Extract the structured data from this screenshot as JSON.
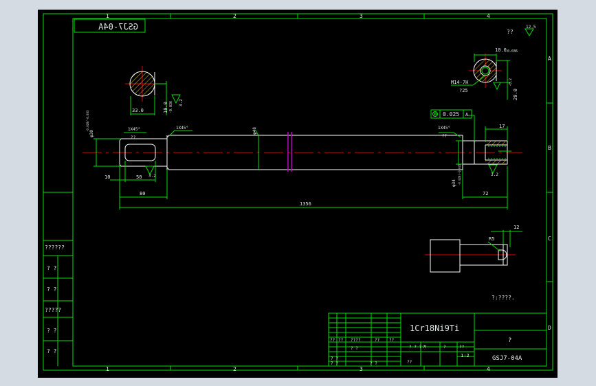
{
  "drawing": {
    "part_number_flipped": "GSJ7-04A",
    "zone_numbers_top": [
      "1",
      "2",
      "3",
      "4"
    ],
    "zone_numbers_bottom": [
      "1",
      "2",
      "3",
      "4"
    ],
    "zone_letters_right": [
      "A",
      "B",
      "C",
      "D"
    ],
    "roughness_top_right": "?? ",
    "roughness_top_right_value": "12.5",
    "left_section": {
      "width_dim": "33.0",
      "depth_dim": "10.0",
      "depth_tol": "-0.036",
      "roughness": "3.2"
    },
    "left_end": {
      "chamfer": "1X45°",
      "chamfer_note": "??",
      "dia_label": "φ30",
      "dia_tol": "-0.020/-0.033",
      "offset_dim": "10",
      "key_dim": "50",
      "length_dim": "80",
      "roughness": "3.2"
    },
    "middle": {
      "chamfer": "1X45°",
      "dia_label": "φ48"
    },
    "right_end": {
      "chamfer": "1X45°",
      "chamfer_note": "??",
      "dia_label": "φ34",
      "dia_tol": "-0.020/-0.035",
      "length_dim": "72",
      "hole_dim": "17",
      "roughness": "3.2",
      "tolerance_frame": "0.025",
      "datum": "A"
    },
    "overall_length": "1356",
    "right_section": {
      "width_dim": "10.0",
      "width_tol": "-0.036",
      "thread": "M14-7H",
      "thread_depth": "?25",
      "height_dim": "29.0",
      "height_tol": "-0.2",
      "roughness": "3.2"
    },
    "detail_view": {
      "radius": "R5",
      "length": "12"
    },
    "note_right": "?:????.",
    "left_strip_labels": [
      "??????",
      "?   ?",
      "?   ?",
      "?????",
      "?   ?",
      "?   ?"
    ],
    "title_block": {
      "material": "1Cr18Ni9Ti",
      "unit_field": "?",
      "drawing_no": "GSJ7-04A",
      "scale": "1:2",
      "row_labels": [
        "??",
        "??",
        "????",
        "??",
        "??",
        "??"
      ],
      "mid_labels": [
        "? ? ? ?",
        "?",
        "?",
        "??"
      ],
      "bottom_labels": [
        "? ?",
        "? ?",
        "? ?",
        "? ?"
      ]
    }
  }
}
